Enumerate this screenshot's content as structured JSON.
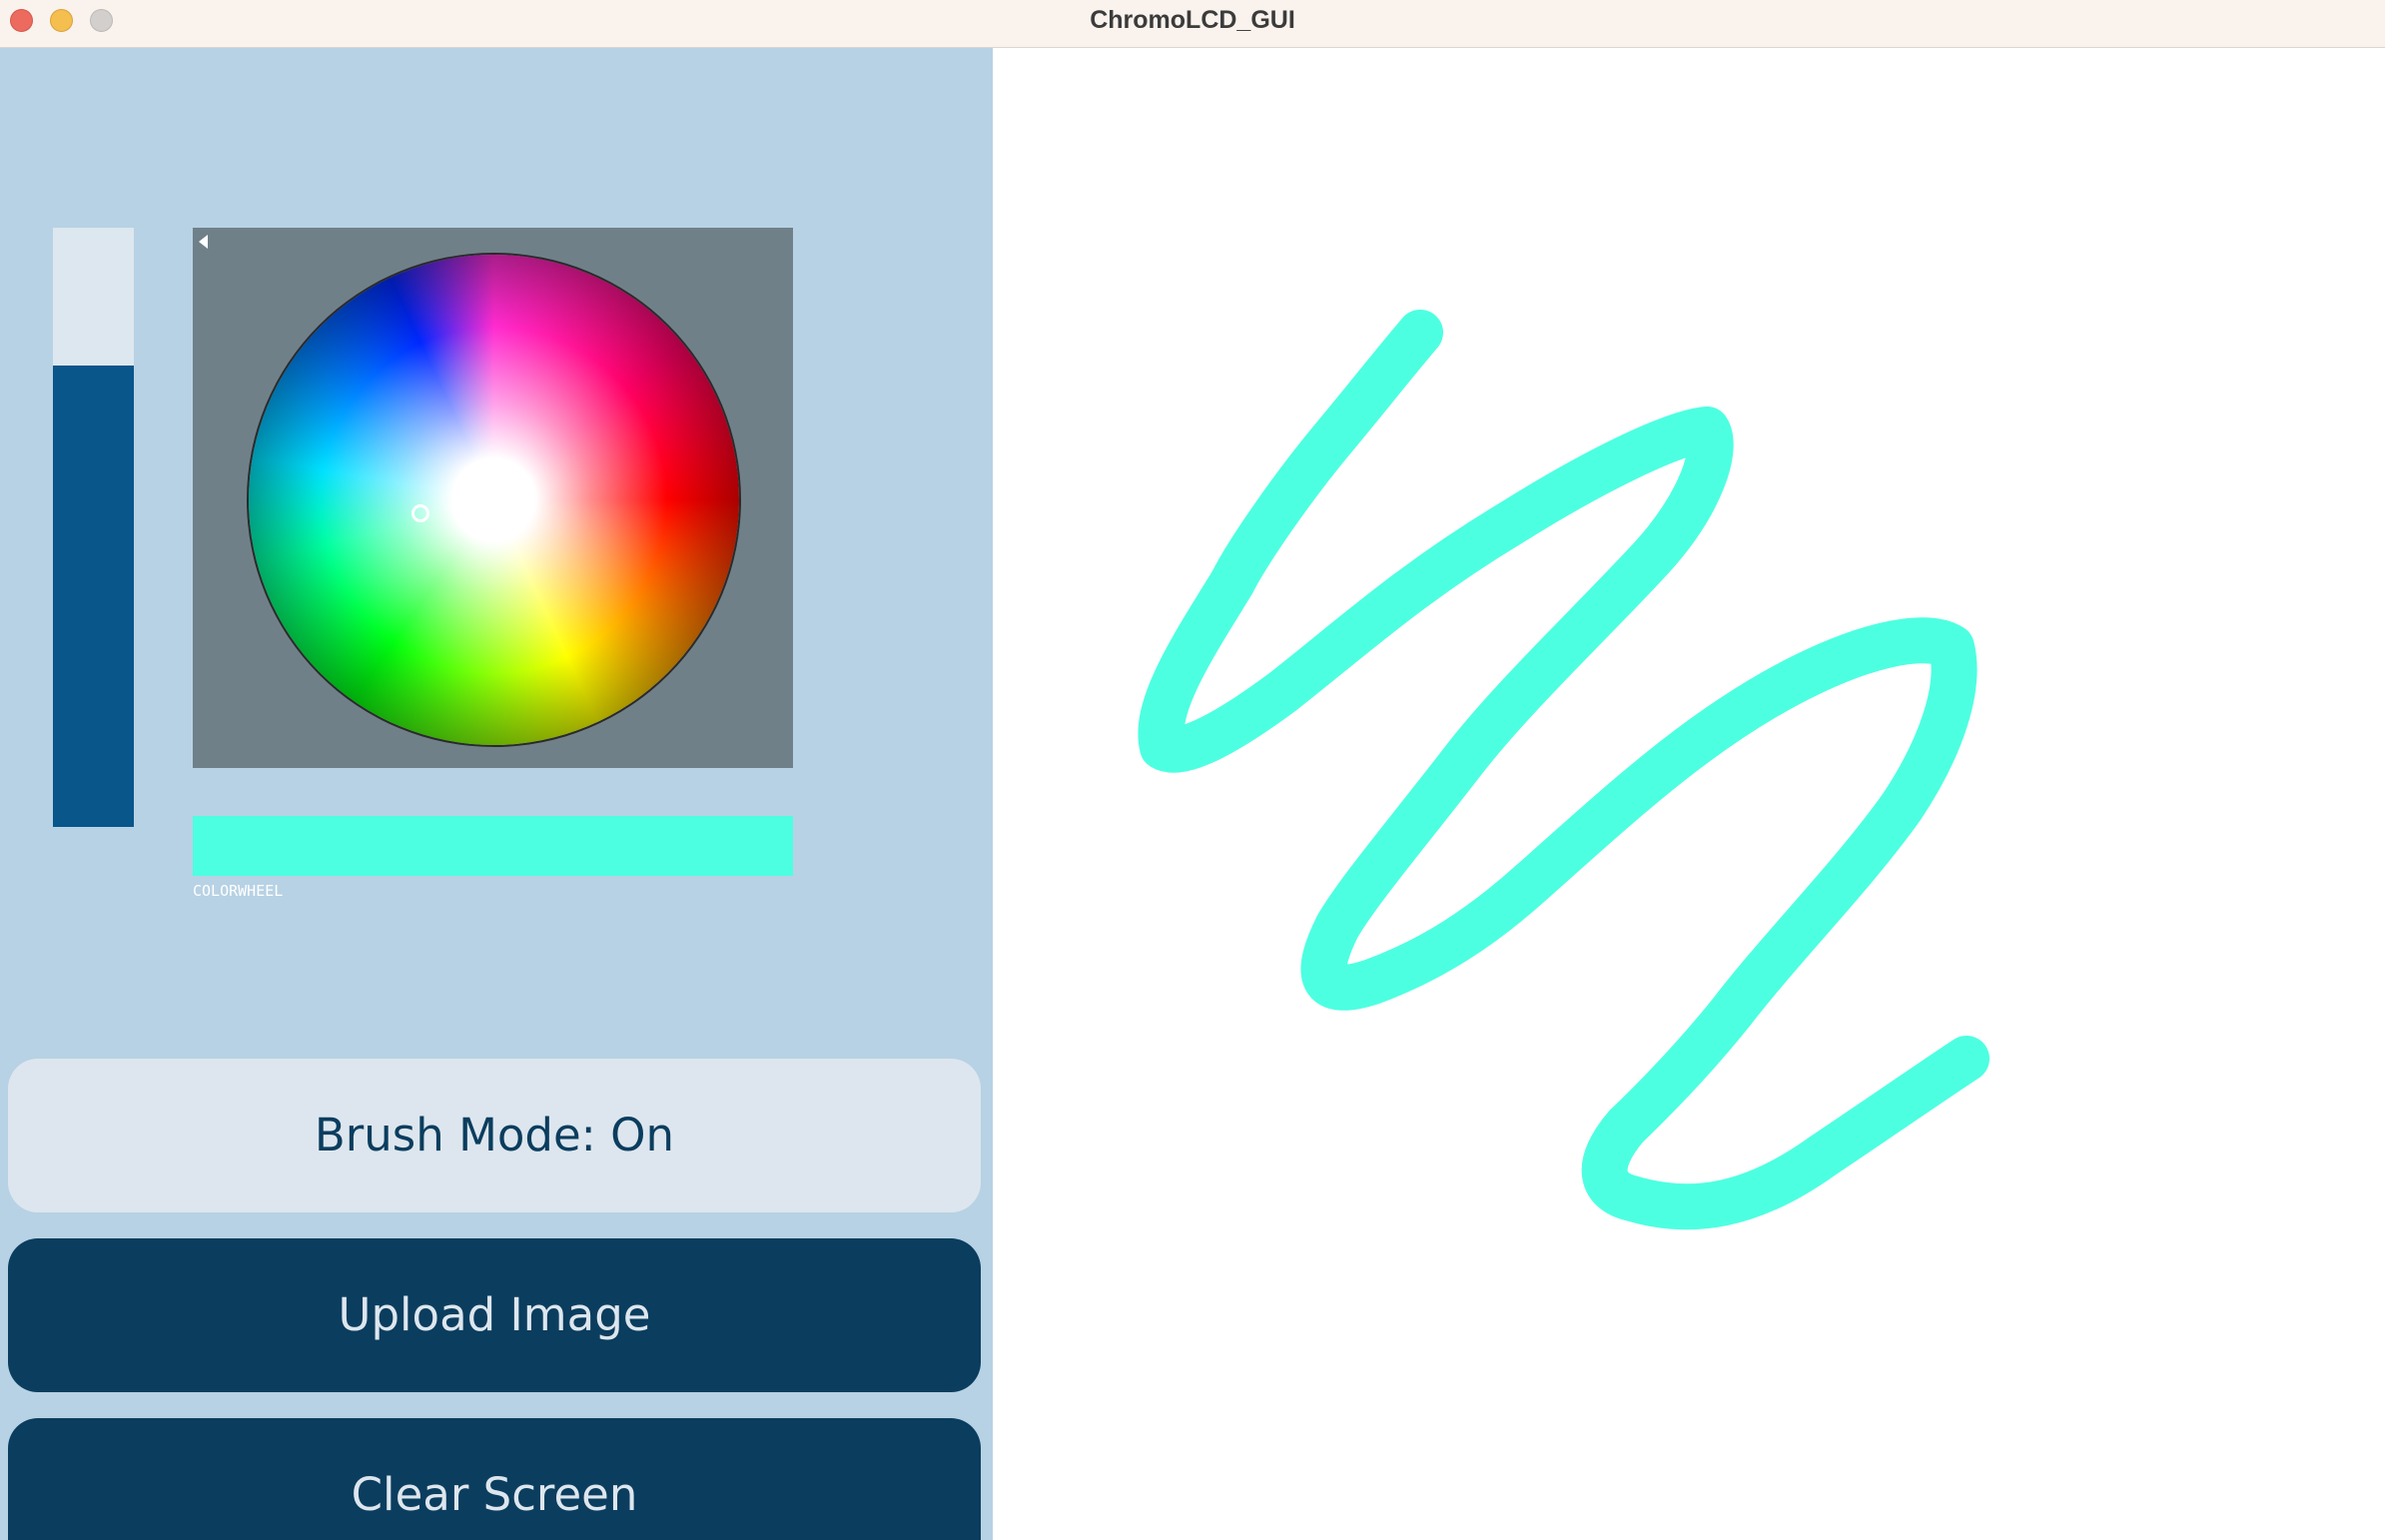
{
  "window": {
    "title": "ChromoLCD_GUI"
  },
  "brightness_slider": {
    "level": 0.77,
    "fill_color": "#08568a",
    "track_color": "#dde7ef"
  },
  "color_wheel": {
    "label": "COLORWHEEL",
    "background_color": "#6f8089",
    "selected_color": "#4dffe1"
  },
  "buttons": {
    "brush_mode": "Brush Mode: On",
    "upload_image": "Upload Image",
    "clear_screen": "Clear Screen"
  },
  "canvas": {
    "stroke_color": "#4dffe1"
  }
}
